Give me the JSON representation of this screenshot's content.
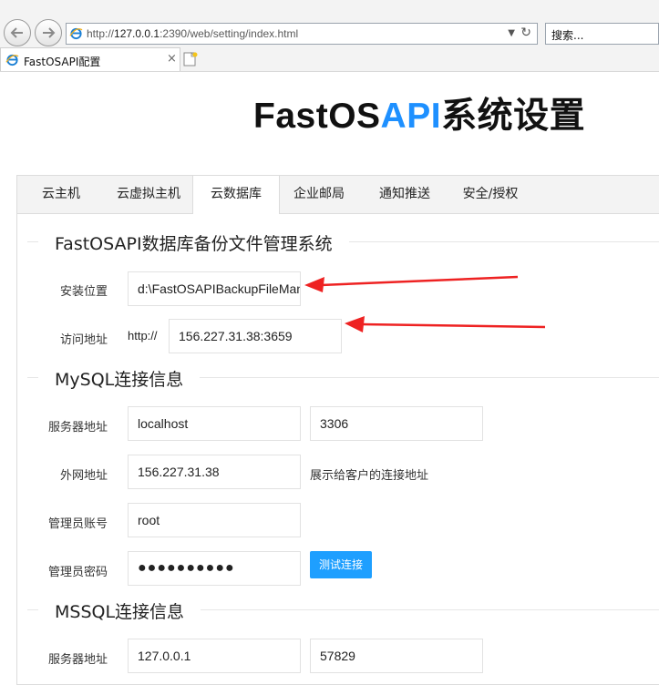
{
  "browser": {
    "url_prefix": "http://",
    "url_host": "127.0.0.1",
    "url_rest": ":2390/web/setting/index.html",
    "search_placeholder": "搜索...",
    "tab_title": "FastOSAPI配置",
    "tab_close": "×"
  },
  "page": {
    "title_part1": "FastOS",
    "title_part2": "API",
    "title_part3": "系统设置",
    "accent_color": "#1e90ff"
  },
  "tabs": [
    {
      "label": "云主机"
    },
    {
      "label": "云虚拟主机"
    },
    {
      "label": "云数据库",
      "active": true
    },
    {
      "label": "企业邮局"
    },
    {
      "label": "通知推送"
    },
    {
      "label": "安全/授权"
    }
  ],
  "backup": {
    "section_title": "FastOSAPI数据库备份文件管理系统",
    "install_label": "安装位置",
    "install_value": "d:\\FastOSAPIBackupFileManager",
    "access_label": "访问地址",
    "access_prefix": "http://",
    "access_value": "156.227.31.38:3659"
  },
  "mysql": {
    "section_title": "MySQL连接信息",
    "server_label": "服务器地址",
    "server_value": "localhost",
    "port_value": "3306",
    "public_label": "外网地址",
    "public_value": "156.227.31.38",
    "public_note": "展示给客户的连接地址",
    "admin_label": "管理员账号",
    "admin_value": "root",
    "password_label": "管理员密码",
    "password_value": "●●●●●●●●●●",
    "test_button": "测试连接"
  },
  "mssql": {
    "section_title": "MSSQL连接信息",
    "server_label": "服务器地址",
    "server_value": "127.0.0.1",
    "port_value": "57829"
  }
}
